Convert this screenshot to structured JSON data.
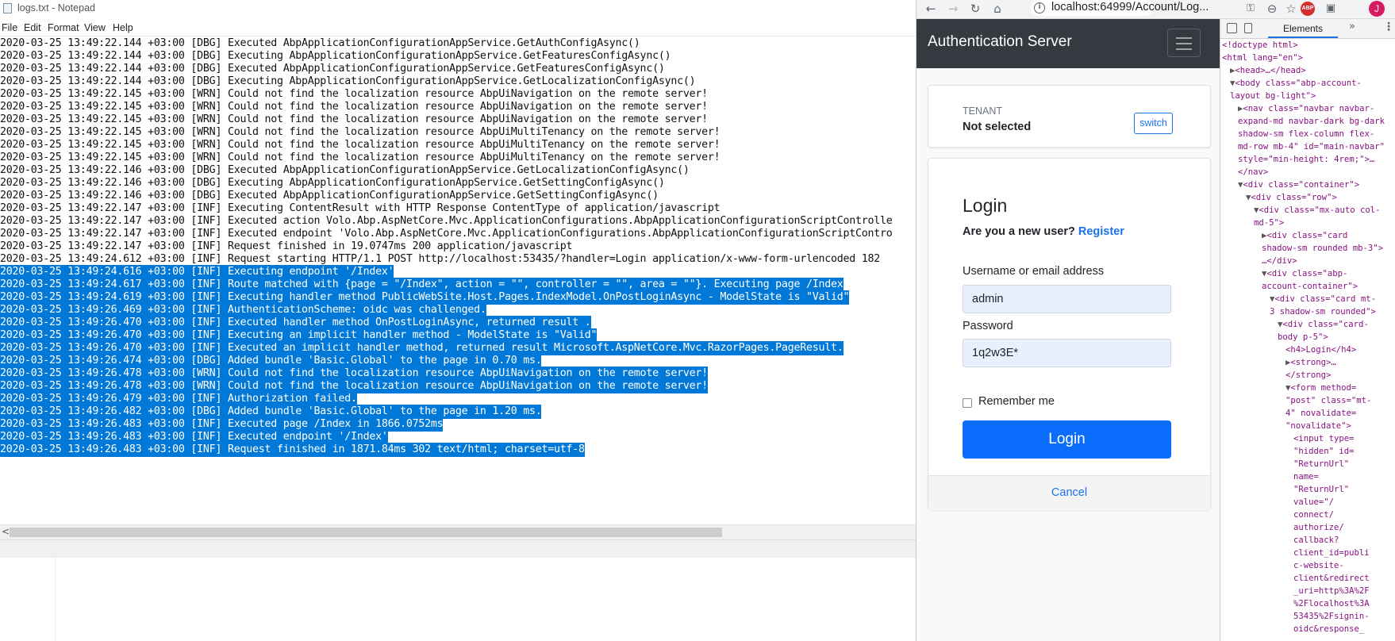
{
  "notepad": {
    "title": "logs.txt - Notepad",
    "menu": [
      "File",
      "Edit",
      "Format",
      "View",
      "Help"
    ],
    "lines": [
      {
        "text": "2020-03-25 13:49:22.144 +03:00 [DBG] Executed AbpApplicationConfigurationAppService.GetAuthConfigAsync()",
        "selected": false
      },
      {
        "text": "2020-03-25 13:49:22.144 +03:00 [DBG] Executing AbpApplicationConfigurationAppService.GetFeaturesConfigAsync()",
        "selected": false
      },
      {
        "text": "2020-03-25 13:49:22.144 +03:00 [DBG] Executed AbpApplicationConfigurationAppService.GetFeaturesConfigAsync()",
        "selected": false
      },
      {
        "text": "2020-03-25 13:49:22.144 +03:00 [DBG] Executing AbpApplicationConfigurationAppService.GetLocalizationConfigAsync()",
        "selected": false
      },
      {
        "text": "2020-03-25 13:49:22.145 +03:00 [WRN] Could not find the localization resource AbpUiNavigation on the remote server!",
        "selected": false
      },
      {
        "text": "2020-03-25 13:49:22.145 +03:00 [WRN] Could not find the localization resource AbpUiNavigation on the remote server!",
        "selected": false
      },
      {
        "text": "2020-03-25 13:49:22.145 +03:00 [WRN] Could not find the localization resource AbpUiNavigation on the remote server!",
        "selected": false
      },
      {
        "text": "2020-03-25 13:49:22.145 +03:00 [WRN] Could not find the localization resource AbpUiMultiTenancy on the remote server!",
        "selected": false
      },
      {
        "text": "2020-03-25 13:49:22.145 +03:00 [WRN] Could not find the localization resource AbpUiMultiTenancy on the remote server!",
        "selected": false
      },
      {
        "text": "2020-03-25 13:49:22.145 +03:00 [WRN] Could not find the localization resource AbpUiMultiTenancy on the remote server!",
        "selected": false
      },
      {
        "text": "2020-03-25 13:49:22.146 +03:00 [DBG] Executed AbpApplicationConfigurationAppService.GetLocalizationConfigAsync()",
        "selected": false
      },
      {
        "text": "2020-03-25 13:49:22.146 +03:00 [DBG] Executing AbpApplicationConfigurationAppService.GetSettingConfigAsync()",
        "selected": false
      },
      {
        "text": "2020-03-25 13:49:22.146 +03:00 [DBG] Executed AbpApplicationConfigurationAppService.GetSettingConfigAsync()",
        "selected": false
      },
      {
        "text": "2020-03-25 13:49:22.147 +03:00 [INF] Executing ContentResult with HTTP Response ContentType of application/javascript",
        "selected": false
      },
      {
        "text": "2020-03-25 13:49:22.147 +03:00 [INF] Executed action Volo.Abp.AspNetCore.Mvc.ApplicationConfigurations.AbpApplicationConfigurationScriptControlle",
        "selected": false
      },
      {
        "text": "2020-03-25 13:49:22.147 +03:00 [INF] Executed endpoint 'Volo.Abp.AspNetCore.Mvc.ApplicationConfigurations.AbpApplicationConfigurationScriptContro",
        "selected": false
      },
      {
        "text": "2020-03-25 13:49:22.147 +03:00 [INF] Request finished in 19.0747ms 200 application/javascript",
        "selected": false
      },
      {
        "text": "2020-03-25 13:49:24.612 +03:00 [INF] Request starting HTTP/1.1 POST http://localhost:53435/?handler=Login application/x-www-form-urlencoded 182",
        "selected": false
      },
      {
        "text": "2020-03-25 13:49:24.616 +03:00 [INF] Executing endpoint '/Index'",
        "selected": true
      },
      {
        "text": "2020-03-25 13:49:24.617 +03:00 [INF] Route matched with {page = \"/Index\", action = \"\", controller = \"\", area = \"\"}. Executing page /Index",
        "selected": true
      },
      {
        "text": "2020-03-25 13:49:24.619 +03:00 [INF] Executing handler method PublicWebSite.Host.Pages.IndexModel.OnPostLoginAsync - ModelState is \"Valid\"",
        "selected": true
      },
      {
        "text": "2020-03-25 13:49:26.469 +03:00 [INF] AuthenticationScheme: oidc was challenged.",
        "selected": true
      },
      {
        "text": "2020-03-25 13:49:26.470 +03:00 [INF] Executed handler method OnPostLoginAsync, returned result .",
        "selected": true
      },
      {
        "text": "2020-03-25 13:49:26.470 +03:00 [INF] Executing an implicit handler method - ModelState is \"Valid\"",
        "selected": true
      },
      {
        "text": "2020-03-25 13:49:26.470 +03:00 [INF] Executed an implicit handler method, returned result Microsoft.AspNetCore.Mvc.RazorPages.PageResult.",
        "selected": true
      },
      {
        "text": "2020-03-25 13:49:26.474 +03:00 [DBG] Added bundle 'Basic.Global' to the page in 0.70 ms.",
        "selected": true
      },
      {
        "text": "2020-03-25 13:49:26.478 +03:00 [WRN] Could not find the localization resource AbpUiNavigation on the remote server!",
        "selected": true
      },
      {
        "text": "2020-03-25 13:49:26.478 +03:00 [WRN] Could not find the localization resource AbpUiNavigation on the remote server!",
        "selected": true
      },
      {
        "text": "2020-03-25 13:49:26.479 +03:00 [INF] Authorization failed.",
        "selected": true
      },
      {
        "text": "2020-03-25 13:49:26.482 +03:00 [DBG] Added bundle 'Basic.Global' to the page in 1.20 ms.",
        "selected": true
      },
      {
        "text": "2020-03-25 13:49:26.483 +03:00 [INF] Executed page /Index in 1866.0752ms",
        "selected": true
      },
      {
        "text": "2020-03-25 13:49:26.483 +03:00 [INF] Executed endpoint '/Index'",
        "selected": true
      },
      {
        "text": "2020-03-25 13:49:26.483 +03:00 [INF] Request finished in 1871.84ms 302 text/html; charset=utf-8",
        "selected": true
      }
    ],
    "scroll_left_arrow": "<"
  },
  "browser": {
    "url": "localhost:64999/Account/Log...",
    "ext_abp": "ABP",
    "avatar": "J",
    "icons": [
      "back-icon",
      "forward-icon",
      "reload-icon",
      "home-icon",
      "info-icon",
      "key-icon",
      "zoom-icon",
      "star-icon",
      "adblock-icon",
      "extension-icon",
      "avatar-icon",
      "menu-icon"
    ],
    "navbar_brand": "Authentication Server",
    "tenant": {
      "label": "TENANT",
      "value": "Not selected",
      "switch_label": "switch"
    },
    "login": {
      "title": "Login",
      "new_user_text": "Are you a new user?",
      "register_link": "Register",
      "username_label": "Username or email address",
      "username_value": "admin",
      "password_label": "Password",
      "password_value": "1q2w3E*",
      "remember_label": "Remember me",
      "login_button": "Login",
      "cancel_link": "Cancel"
    }
  },
  "devtools": {
    "tab": "Elements",
    "more": "»",
    "kebab": "⋮",
    "lines": [
      {
        "indent": 0,
        "arrow": "",
        "text": "<!doctype html>"
      },
      {
        "indent": 0,
        "arrow": "",
        "text": "<html lang=\"en\">"
      },
      {
        "indent": 1,
        "arrow": "▶",
        "text": "<head>…</head>"
      },
      {
        "indent": 1,
        "arrow": "▼",
        "text": "<body class=\"abp-account-"
      },
      {
        "indent": 1,
        "arrow": "",
        "text": "layout bg-light\">"
      },
      {
        "indent": 2,
        "arrow": "▶",
        "text": "<nav class=\"navbar navbar-"
      },
      {
        "indent": 2,
        "arrow": "",
        "text": "expand-md navbar-dark bg-dark"
      },
      {
        "indent": 2,
        "arrow": "",
        "text": "shadow-sm flex-column flex-"
      },
      {
        "indent": 2,
        "arrow": "",
        "text": "md-row mb-4\" id=\"main-navbar\""
      },
      {
        "indent": 2,
        "arrow": "",
        "text": "style=\"min-height: 4rem;\">…"
      },
      {
        "indent": 2,
        "arrow": "",
        "text": "</nav>"
      },
      {
        "indent": 2,
        "arrow": "▼",
        "text": "<div class=\"container\">"
      },
      {
        "indent": 3,
        "arrow": "▼",
        "text": "<div class=\"row\">"
      },
      {
        "indent": 4,
        "arrow": "▼",
        "text": "<div class=\"mx-auto col-"
      },
      {
        "indent": 4,
        "arrow": "",
        "text": "md-5\">"
      },
      {
        "indent": 5,
        "arrow": "▶",
        "text": "<div class=\"card"
      },
      {
        "indent": 5,
        "arrow": "",
        "text": "shadow-sm rounded mb-3\">"
      },
      {
        "indent": 5,
        "arrow": "",
        "text": "…</div>"
      },
      {
        "indent": 5,
        "arrow": "▼",
        "text": "<div class=\"abp-"
      },
      {
        "indent": 5,
        "arrow": "",
        "text": "account-container\">"
      },
      {
        "indent": 6,
        "arrow": "▼",
        "text": "<div class=\"card mt-"
      },
      {
        "indent": 6,
        "arrow": "",
        "text": "3 shadow-sm rounded\">"
      },
      {
        "indent": 7,
        "arrow": "▼",
        "text": "<div class=\"card-"
      },
      {
        "indent": 7,
        "arrow": "",
        "text": "body p-5\">"
      },
      {
        "indent": 8,
        "arrow": "",
        "text": "<h4>Login</h4>"
      },
      {
        "indent": 8,
        "arrow": "▶",
        "text": "<strong>…"
      },
      {
        "indent": 8,
        "arrow": "",
        "text": "</strong>"
      },
      {
        "indent": 8,
        "arrow": "▼",
        "text": "<form method="
      },
      {
        "indent": 8,
        "arrow": "",
        "text": "\"post\" class=\"mt-"
      },
      {
        "indent": 8,
        "arrow": "",
        "text": "4\" novalidate="
      },
      {
        "indent": 8,
        "arrow": "",
        "text": "\"novalidate\">"
      },
      {
        "indent": 9,
        "arrow": "",
        "text": "<input type="
      },
      {
        "indent": 9,
        "arrow": "",
        "text": "\"hidden\" id="
      },
      {
        "indent": 9,
        "arrow": "",
        "text": "\"ReturnUrl\""
      },
      {
        "indent": 9,
        "arrow": "",
        "text": "name="
      },
      {
        "indent": 9,
        "arrow": "",
        "text": "\"ReturnUrl\""
      },
      {
        "indent": 9,
        "arrow": "",
        "text": "value=\"/"
      },
      {
        "indent": 9,
        "arrow": "",
        "text": "connect/"
      },
      {
        "indent": 9,
        "arrow": "",
        "text": "authorize/"
      },
      {
        "indent": 9,
        "arrow": "",
        "text": "callback?"
      },
      {
        "indent": 9,
        "arrow": "",
        "text": "client_id=publi"
      },
      {
        "indent": 9,
        "arrow": "",
        "text": "c-website-"
      },
      {
        "indent": 9,
        "arrow": "",
        "text": "client&redirect"
      },
      {
        "indent": 9,
        "arrow": "",
        "text": "_uri=http%3A%2F"
      },
      {
        "indent": 9,
        "arrow": "",
        "text": "%2Flocalhost%3A"
      },
      {
        "indent": 9,
        "arrow": "",
        "text": "53435%2Fsignin-"
      },
      {
        "indent": 9,
        "arrow": "",
        "text": "oidc&response_"
      }
    ]
  },
  "colors": {
    "selection": "#0078d7",
    "navbar": "#343a40",
    "primary": "#0b6dfb",
    "link": "#1a73e8"
  }
}
